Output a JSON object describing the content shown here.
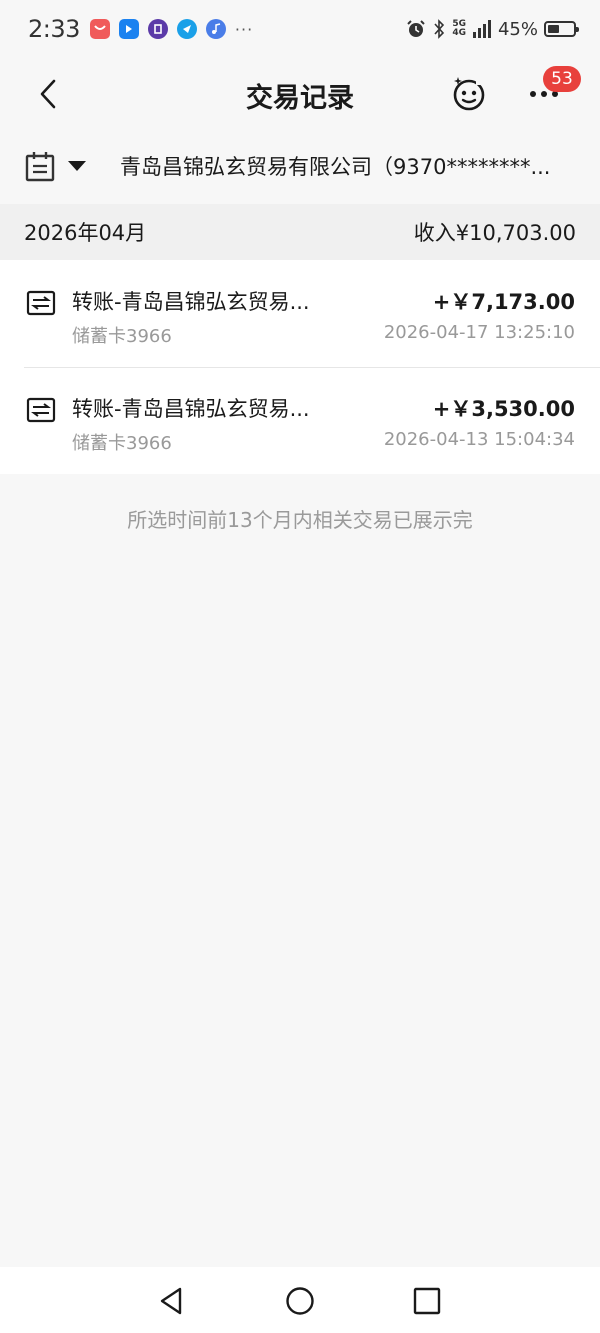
{
  "status_bar": {
    "time": "2:33",
    "battery_percent": "45%",
    "battery_level": 0.45,
    "network_label_top": "5G",
    "network_label_bottom": "4G",
    "icons": [
      "red-shopping-icon",
      "blue-app-icon",
      "purple-tie-icon",
      "cyan-app-icon",
      "music-icon",
      "more-dots-icon",
      "alarm-icon",
      "bluetooth-icon",
      "signal-icon",
      "battery-icon"
    ],
    "more_dots": "···"
  },
  "header": {
    "title": "交易记录",
    "badge_count": "53"
  },
  "filter": {
    "account_name": "青岛昌锦弘玄贸易有限公司（9370********..."
  },
  "summary": {
    "month": "2026年04月",
    "income": "收入¥10,703.00"
  },
  "transactions": [
    {
      "title": "转账-青岛昌锦弘玄贸易...",
      "amount": "+￥7,173.00",
      "card": "储蓄卡3966",
      "time": "2026-04-17 13:25:10"
    },
    {
      "title": "转账-青岛昌锦弘玄贸易...",
      "amount": "+￥3,530.00",
      "card": "储蓄卡3966",
      "time": "2026-04-13 15:04:34"
    }
  ],
  "end_note": "所选时间前13个月内相关交易已展示完",
  "colors": {
    "background": "#f7f7f7",
    "badge": "#e8403c",
    "secondary_text": "#999999"
  }
}
